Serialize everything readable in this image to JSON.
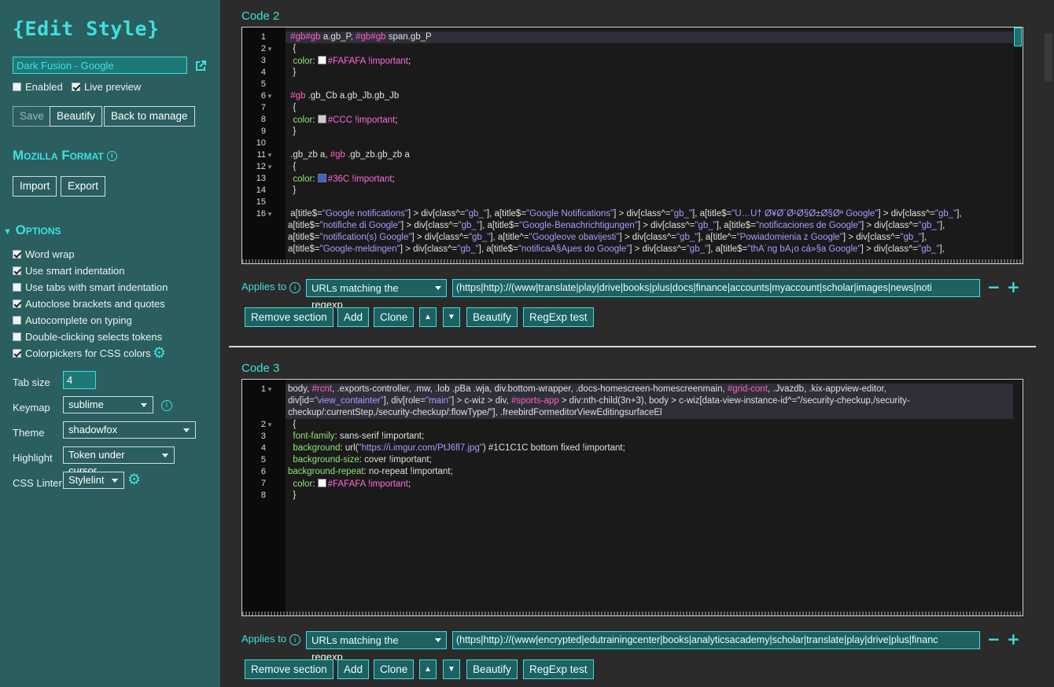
{
  "sidebar": {
    "title": "{Edit Style}",
    "style_name": "Dark Fusion - Google",
    "enabled_label": "Enabled",
    "enabled": false,
    "live_preview_label": "Live preview",
    "live_preview": true,
    "buttons": {
      "save": "Save",
      "beautify": "Beautify",
      "back": "Back to manage"
    },
    "mozilla_format": "Mozilla Format",
    "import": "Import",
    "export": "Export",
    "options_header": "Options",
    "options": [
      {
        "label": "Word wrap",
        "checked": true
      },
      {
        "label": "Use smart indentation",
        "checked": true
      },
      {
        "label": "Use tabs with smart indentation",
        "checked": false
      },
      {
        "label": "Autoclose brackets and quotes",
        "checked": true
      },
      {
        "label": "Autocomplete on typing",
        "checked": false
      },
      {
        "label": "Double-clicking selects tokens",
        "checked": false
      },
      {
        "label": "Colorpickers for CSS colors",
        "checked": true
      }
    ],
    "tab_size_label": "Tab size",
    "tab_size": "4",
    "keymap_label": "Keymap",
    "keymap": "sublime",
    "theme_label": "Theme",
    "theme": "shadowfox",
    "highlight_label": "Highlight",
    "highlight": "Token under cursor",
    "linter_label": "CSS Linter",
    "linter": "Stylelint"
  },
  "sections": [
    {
      "title": "Code 2",
      "applies_label": "Applies to",
      "applies_type": "URLs matching the regexp",
      "regexp": "(https|http)://(www|translate|play|drive|books|plus|docs|finance|accounts|myaccount|scholar|images|news|noti",
      "buttons": {
        "remove": "Remove section",
        "add": "Add",
        "clone": "Clone",
        "up": "▲",
        "down": "▼",
        "beautify": "Beautify",
        "regexp_test": "RegExp test"
      },
      "line_numbers": [
        "1",
        "2",
        "3",
        "4",
        "5",
        "6",
        "7",
        "8",
        "9",
        "10",
        "11",
        "12",
        "13",
        "14",
        "15",
        "16"
      ],
      "code": [
        "#gb#gb a.gb_P, #gb#gb span.gb_P",
        "{",
        "color: #FAFAFA !important;",
        "}",
        "",
        "#gb .gb_Cb a.gb_Jb.gb_Jb",
        "{",
        "color: #CCC !important;",
        "}",
        "",
        ".gb_zb a, #gb .gb_zb.gb_zb a",
        "{",
        "color: #36C !important;",
        "}",
        "",
        "a[title$=\"Google notifications\"] > div[class^=\"gb_\"], a[title$=\"Google Notifications\"] > div[class^=\"gb_\"], a[title$=\"Ù…Ù† Ø¥Ø´Ø¹Ø§Ø±Ø§Øª Google\"] > div[class^=\"gb_\"],",
        "a[title$=\"notifiche di Google\"] > div[class^=\"gb_\"], a[title$=\"Google-Benachrichtigungen\"] > div[class^=\"gb_\"], a[title$=\"notificaciones de Google\"] > div[class^=\"gb_\"],",
        "a[title$=\"notification(s) Google\"] > div[class^=\"gb_\"], a[title^=\"Googleove obavijesti\"] > div[class^=\"gb_\"], a[title^=\"Powiadomienia z Google\"] > div[class^=\"gb_\"],",
        "a[title$=\"Google-meldingen\"] > div[class^=\"gb_\"], a[title$=\"notificaÃ§Ãµes do Google\"] > div[class^=\"gb_\"], a[title$=\"thÃ´ng bÃ¡o cá»§a Google\"] > div[class^=\"gb_\"],"
      ]
    },
    {
      "title": "Code 3",
      "applies_label": "Applies to",
      "applies_type": "URLs matching the regexp",
      "regexp": "(https|http)://(www|encrypted|edutrainingcenter|books|analyticsacademy|scholar|translate|play|drive|plus|financ",
      "buttons": {
        "remove": "Remove section",
        "add": "Add",
        "clone": "Clone",
        "up": "▲",
        "down": "▼",
        "beautify": "Beautify",
        "regexp_test": "RegExp test"
      },
      "line_numbers": [
        "1",
        "2",
        "3",
        "4",
        "5",
        "6",
        "7",
        "8"
      ],
      "code": [
        "body, #rcnt, .exports-controller, .mw, .lob .pBa .wja, div.bottom-wrapper, .docs-homescreen-homescreenmain, #grid-cont, .Jvazdb, .kix-appview-editor,",
        "div[id=\"view_containter\"], div[role=\"main\"] > c-wiz > div, #sports-app > div:nth-child(3n+3), body > c-wiz[data-view-instance-id^=\"/security-checkup,/security-",
        "checkup/:currentStep,/security-checkup/:flowType/\"], .freebirdFormeditorViewEditingsurfaceEl",
        "{",
        "font-family: sans-serif !important;",
        "background: url(\"https://i.imgur.com/PtJ6fl7.jpg\") #1C1C1C bottom fixed !important;",
        "background-size: cover !important;",
        "background-repeat: no-repeat !important;",
        "color: #FAFAFA !important;",
        "}"
      ]
    }
  ],
  "colors": {
    "accent": "#3ee0e0",
    "sidebar_bg": "#2b5e5e",
    "editor_bg": "#1a1a1a",
    "swatch_fafafa": "#FAFAFA",
    "swatch_ccc": "#CCCCCC",
    "swatch_36c": "#3366CC",
    "swatch_1c1c1c": "#1C1C1C"
  },
  "icons": {
    "external_link": "external-link-icon",
    "info": "info-icon",
    "gear": "gear-icon",
    "minus": "minus-icon",
    "plus": "plus-icon",
    "collapse": "triangle-down-icon"
  }
}
